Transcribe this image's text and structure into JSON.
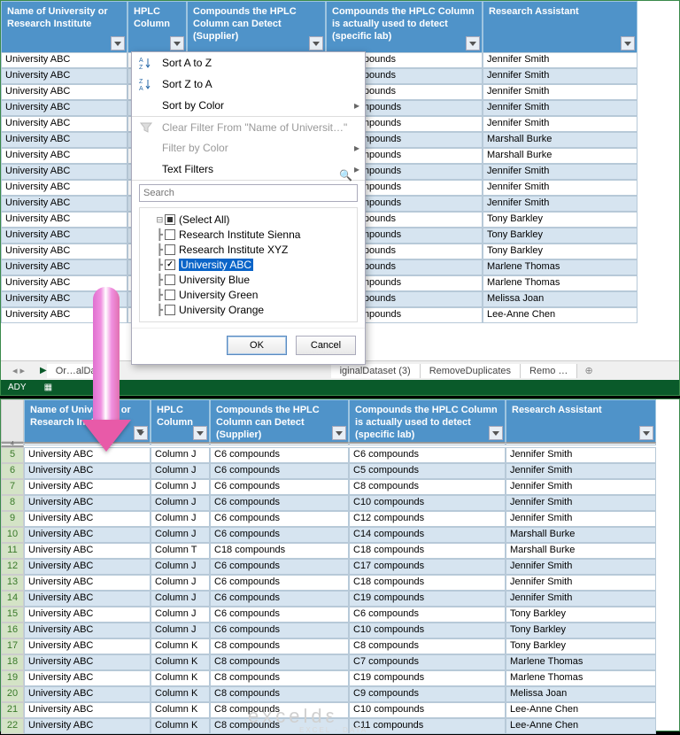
{
  "columns": [
    "Name of University or Research Institute",
    "HPLC Column",
    "Compounds the HPLC Column can Detect (Supplier)",
    "Compounds the HPLC Column is actually used to detect (specific lab)",
    "Research Assistant"
  ],
  "top_rows_compounds": [
    "C6 compounds",
    "C5 compounds",
    "C8 compounds",
    "C10 compounds",
    "C12 compounds",
    "C14 compounds",
    "C18 compounds",
    "C17 compounds",
    "C18 compounds",
    "C19 compounds",
    "C6 compounds",
    "C10 compounds",
    "C8 compounds",
    "C7 compounds",
    "C19 compounds",
    "C9 compounds",
    "C10 compounds"
  ],
  "top_rows_ra": [
    "Jennifer Smith",
    "Jennifer Smith",
    "Jennifer Smith",
    "Jennifer Smith",
    "Jennifer Smith",
    "Marshall Burke",
    "Marshall Burke",
    "Jennifer Smith",
    "Jennifer Smith",
    "Jennifer Smith",
    "Tony Barkley",
    "Tony Barkley",
    "Tony Barkley",
    "Marlene Thomas",
    "Marlene Thomas",
    "Melissa Joan",
    "Lee-Anne Chen"
  ],
  "top_rows_uni": "University ABC",
  "menu": {
    "sort_az": "Sort A to Z",
    "sort_za": "Sort Z to A",
    "sort_color": "Sort by Color",
    "clear": "Clear Filter From \"Name of Universit…\"",
    "filter_color": "Filter by Color",
    "text_filters": "Text Filters",
    "search_placeholder": "Search",
    "items": [
      {
        "label": "(Select All)",
        "state": "square"
      },
      {
        "label": "Research Institute Sienna",
        "state": ""
      },
      {
        "label": "Research Institute XYZ",
        "state": ""
      },
      {
        "label": "University ABC",
        "state": "checked",
        "selected": true
      },
      {
        "label": "University Blue",
        "state": ""
      },
      {
        "label": "University Green",
        "state": ""
      },
      {
        "label": "University Orange",
        "state": ""
      }
    ],
    "ok": "OK",
    "cancel": "Cancel"
  },
  "tabs": {
    "a": "Or…alDat…",
    "b": "iginalDataset (3)",
    "c": "RemoveDuplicates",
    "d": "Remo  …"
  },
  "status": "ADY",
  "bottom_rownums": [
    5,
    6,
    7,
    8,
    9,
    10,
    11,
    12,
    13,
    14,
    15,
    16,
    17,
    18,
    19,
    20,
    21,
    22
  ],
  "bottom_rows": [
    [
      "University ABC",
      "Column J",
      "C6 compounds",
      "C6 compounds",
      "Jennifer Smith"
    ],
    [
      "University ABC",
      "Column J",
      "C6 compounds",
      "C5 compounds",
      "Jennifer Smith"
    ],
    [
      "University ABC",
      "Column J",
      "C6 compounds",
      "C8 compounds",
      "Jennifer Smith"
    ],
    [
      "University ABC",
      "Column J",
      "C6 compounds",
      "C10 compounds",
      "Jennifer Smith"
    ],
    [
      "University ABC",
      "Column J",
      "C6 compounds",
      "C12 compounds",
      "Jennifer Smith"
    ],
    [
      "University ABC",
      "Column J",
      "C6 compounds",
      "C14 compounds",
      "Marshall Burke"
    ],
    [
      "University ABC",
      "Column T",
      "C18 compounds",
      "C18 compounds",
      "Marshall Burke"
    ],
    [
      "University ABC",
      "Column J",
      "C6 compounds",
      "C17 compounds",
      "Jennifer Smith"
    ],
    [
      "University ABC",
      "Column J",
      "C6 compounds",
      "C18 compounds",
      "Jennifer Smith"
    ],
    [
      "University ABC",
      "Column J",
      "C6 compounds",
      "C19 compounds",
      "Jennifer Smith"
    ],
    [
      "University ABC",
      "Column J",
      "C6 compounds",
      "C6 compounds",
      "Tony Barkley"
    ],
    [
      "University ABC",
      "Column J",
      "C6 compounds",
      "C10 compounds",
      "Tony Barkley"
    ],
    [
      "University ABC",
      "Column K",
      "C8 compounds",
      "C8 compounds",
      "Tony Barkley"
    ],
    [
      "University ABC",
      "Column K",
      "C8 compounds",
      "C7 compounds",
      "Marlene Thomas"
    ],
    [
      "University ABC",
      "Column K",
      "C8 compounds",
      "C19 compounds",
      "Marlene Thomas"
    ],
    [
      "University ABC",
      "Column K",
      "C8 compounds",
      "C9 compounds",
      "Melissa Joan"
    ],
    [
      "University ABC",
      "Column K",
      "C8 compounds",
      "C10 compounds",
      "Lee-Anne Chen"
    ],
    [
      "University ABC",
      "Column K",
      "C8 compounds",
      "C11 compounds",
      "Lee-Anne Chen"
    ]
  ]
}
